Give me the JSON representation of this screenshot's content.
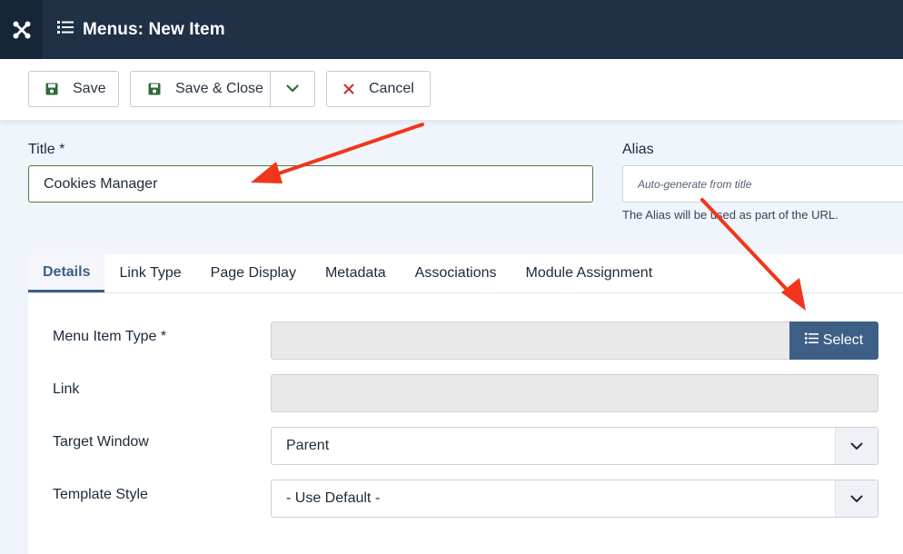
{
  "header": {
    "title": "Menus: New Item",
    "logo_icon": "joomla-logo-icon",
    "title_icon": "list-icon"
  },
  "toolbar": {
    "save_label": "Save",
    "save_close_label": "Save & Close",
    "cancel_label": "Cancel"
  },
  "form": {
    "title_label": "Title *",
    "title_value": "Cookies Manager",
    "alias_label": "Alias",
    "alias_placeholder": "Auto-generate from title",
    "alias_help": "The Alias will be used as part of the URL."
  },
  "tabs": [
    {
      "label": "Details",
      "active": true
    },
    {
      "label": "Link Type"
    },
    {
      "label": "Page Display"
    },
    {
      "label": "Metadata"
    },
    {
      "label": "Associations"
    },
    {
      "label": "Module Assignment"
    }
  ],
  "details": {
    "menu_item_type_label": "Menu Item Type *",
    "select_label": "Select",
    "link_label": "Link",
    "target_window_label": "Target Window",
    "target_window_value": "Parent",
    "template_style_label": "Template Style",
    "template_style_value": "- Use Default -"
  },
  "colors": {
    "header_bg": "#1f3047",
    "accent": "#3e5f85",
    "save_icon": "#2f6b3a",
    "cancel_icon": "#c62828",
    "annotation_arrow": "#f0361b"
  }
}
